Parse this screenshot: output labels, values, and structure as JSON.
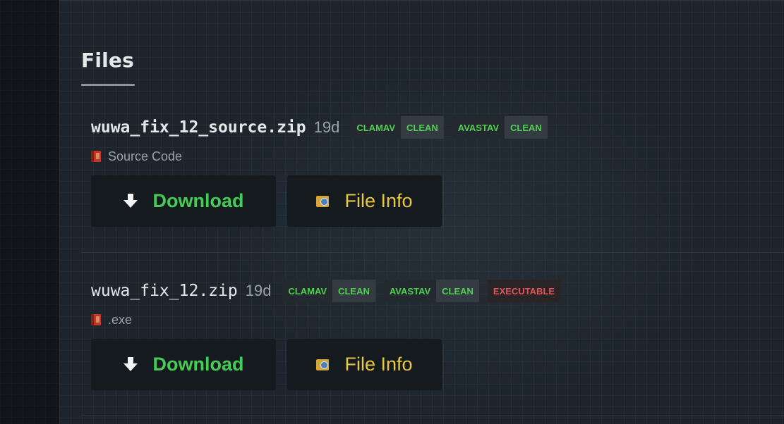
{
  "section": {
    "title": "Files"
  },
  "files": [
    {
      "name": "wuwa_fix_12_source.zip",
      "age": "19d",
      "badges": [
        {
          "label": "CLAMAV",
          "value": "CLEAN"
        },
        {
          "label": "AVASTAV",
          "value": "CLEAN"
        }
      ],
      "description": "Source Code",
      "download_label": "Download",
      "info_label": "File Info"
    },
    {
      "name": "wuwa_fix_12.zip",
      "age": "19d",
      "badges": [
        {
          "label": "CLAMAV",
          "value": "CLEAN"
        },
        {
          "label": "AVASTAV",
          "value": "CLEAN"
        }
      ],
      "flag": "EXECUTABLE",
      "description": ".exe",
      "download_label": "Download",
      "info_label": "File Info"
    }
  ],
  "colors": {
    "download": "#44cc55",
    "file_info": "#e8c742",
    "badge_clean": "#4fd04f",
    "badge_warn": "#e2555a"
  },
  "icons": {
    "download": "arrow-down-icon",
    "file_info": "file-info-icon",
    "description": "book-icon"
  }
}
